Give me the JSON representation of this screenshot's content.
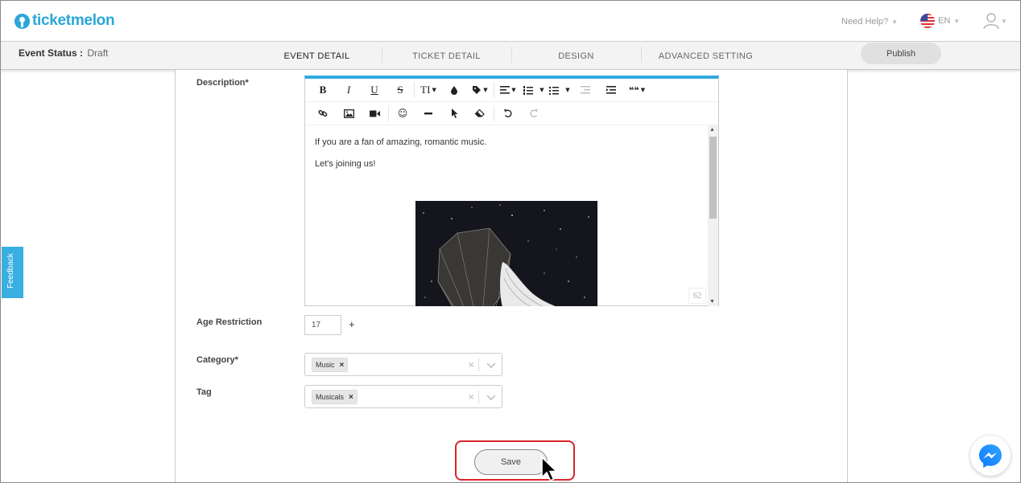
{
  "header": {
    "logo_text": "ticketmelon",
    "help_label": "Need Help?",
    "lang_label": "EN",
    "brand_color": "#2aa7d8"
  },
  "subnav": {
    "status_label": "Event Status :",
    "status_value": "Draft",
    "tabs": [
      "EVENT DETAIL",
      "TICKET DETAIL",
      "DESIGN",
      "ADVANCED SETTING"
    ],
    "active_tab": "EVENT DETAIL",
    "publish_label": "Publish"
  },
  "form": {
    "description_label": "Description*",
    "description_lines": [
      "If you are a fan of amazing, romantic music.",
      "Let's joining us!"
    ],
    "char_counter": "62",
    "age_label": "Age Restriction",
    "age_value": "17",
    "age_plus": "+",
    "category_label": "Category*",
    "category_chip": "Music",
    "tag_label": "Tag",
    "tag_chip": "Musicals",
    "save_label": "Save"
  },
  "toolbar": {
    "row1": [
      "bold-icon",
      "italic-icon",
      "underline-icon",
      "strikethrough-icon",
      "font-size-icon",
      "color-icon",
      "tag-icon",
      "align-icon",
      "ordered-list-icon",
      "unordered-list-icon",
      "outdent-icon",
      "indent-icon",
      "quote-icon"
    ],
    "row2": [
      "link-icon",
      "image-icon",
      "video-icon",
      "emoji-icon",
      "horizontal-rule-icon",
      "select-icon",
      "eraser-icon",
      "undo-icon",
      "redo-icon"
    ],
    "bold_glyph": "B",
    "italic_glyph": "I",
    "underline_glyph": "U",
    "strike_glyph": "S",
    "font_size_glyph": "TI",
    "quote_glyph": "❝❝"
  },
  "feedback_label": "Feedback",
  "accent_colors": {
    "editor_top": "#30a9de",
    "highlight": "#d9252c",
    "feedback": "#39aee0"
  }
}
